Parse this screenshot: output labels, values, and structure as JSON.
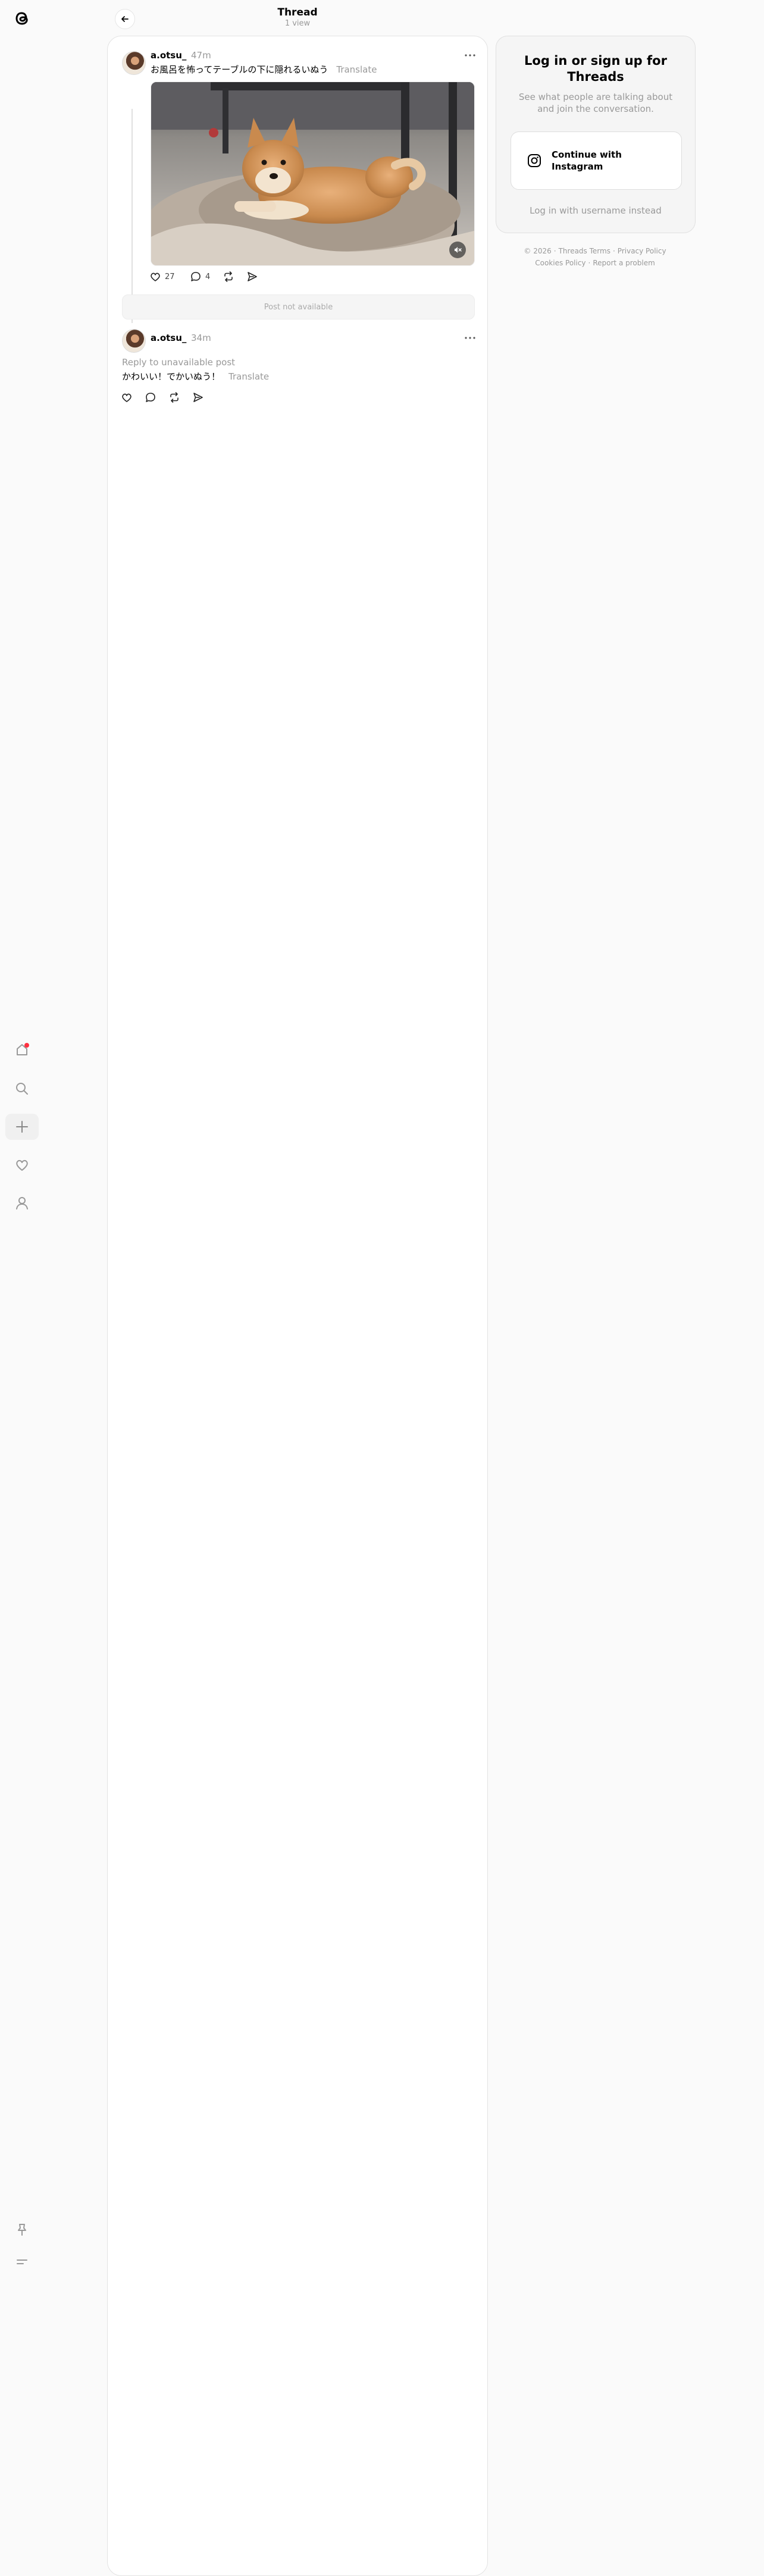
{
  "header": {
    "title": "Thread",
    "subtitle": "1 view"
  },
  "sidebar": {
    "logo": "threads-logo",
    "items": [
      {
        "name": "home",
        "icon": "home-icon",
        "has_notification_dot": true
      },
      {
        "name": "search",
        "icon": "search-icon"
      },
      {
        "name": "create",
        "icon": "plus-icon"
      },
      {
        "name": "activity",
        "icon": "heart-icon"
      },
      {
        "name": "profile",
        "icon": "user-icon"
      }
    ],
    "bottom_items": [
      {
        "name": "pin",
        "icon": "pin-icon"
      },
      {
        "name": "menu",
        "icon": "menu-icon"
      }
    ]
  },
  "thread": {
    "post": {
      "username": "a.otsu_",
      "time": "47m",
      "text": "お風呂を怖ってテーブルの下に隠れるいぬう",
      "translate": "Translate",
      "media_description": "Shiba inu dog lying on a cushion under a table",
      "likes": "27",
      "replies": "4"
    },
    "unavailable_label": "Post not available",
    "reply": {
      "username": "a.otsu_",
      "time": "34m",
      "reply_to": "Reply to unavailable post",
      "text": "かわいい！でかいぬう！",
      "translate": "Translate"
    }
  },
  "login": {
    "title": "Log in or sign up for Threads",
    "subtitle": "See what people are talking about and join the conversation.",
    "instagram_button": "Continue with Instagram",
    "alt_link": "Log in with username instead"
  },
  "footer": {
    "copyright": "© 2026",
    "links_row1": [
      "Threads Terms",
      "Privacy Policy"
    ],
    "links_row2": [
      "Cookies Policy",
      "Report a problem"
    ]
  },
  "colors": {
    "background": "#fafafa",
    "notification_dot": "#ff3040",
    "muted_text": "#999999"
  }
}
